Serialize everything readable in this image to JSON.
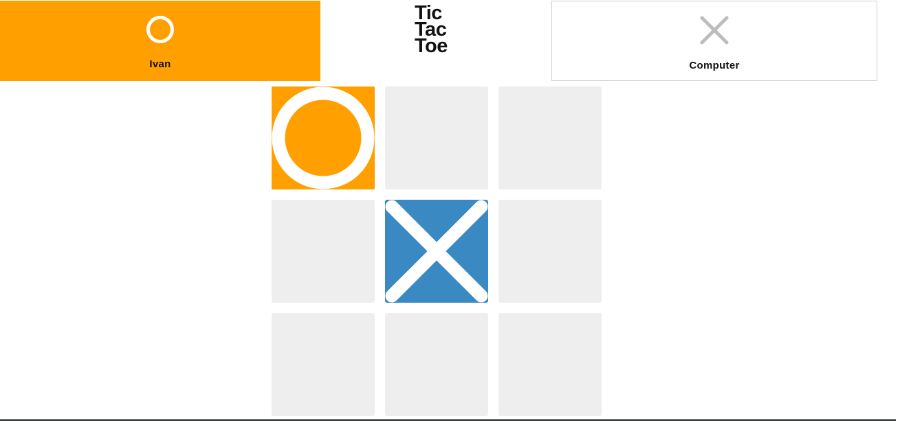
{
  "players": [
    {
      "name": "Ivan",
      "symbol": "O",
      "icon": "o-icon",
      "active": true
    },
    {
      "name": "Computer",
      "symbol": "X",
      "icon": "x-icon",
      "active": false
    }
  ],
  "logo": {
    "lines": [
      "Tic",
      "Tac",
      "Toe"
    ]
  },
  "board": {
    "cells": [
      "O",
      "",
      "",
      "",
      "X",
      "",
      "",
      "",
      ""
    ]
  },
  "colors": {
    "accent": "#ffa000",
    "x_cell": "#3a89c2",
    "empty_cell": "#eeeeee",
    "x_icon_gray": "#bdbdbd"
  }
}
